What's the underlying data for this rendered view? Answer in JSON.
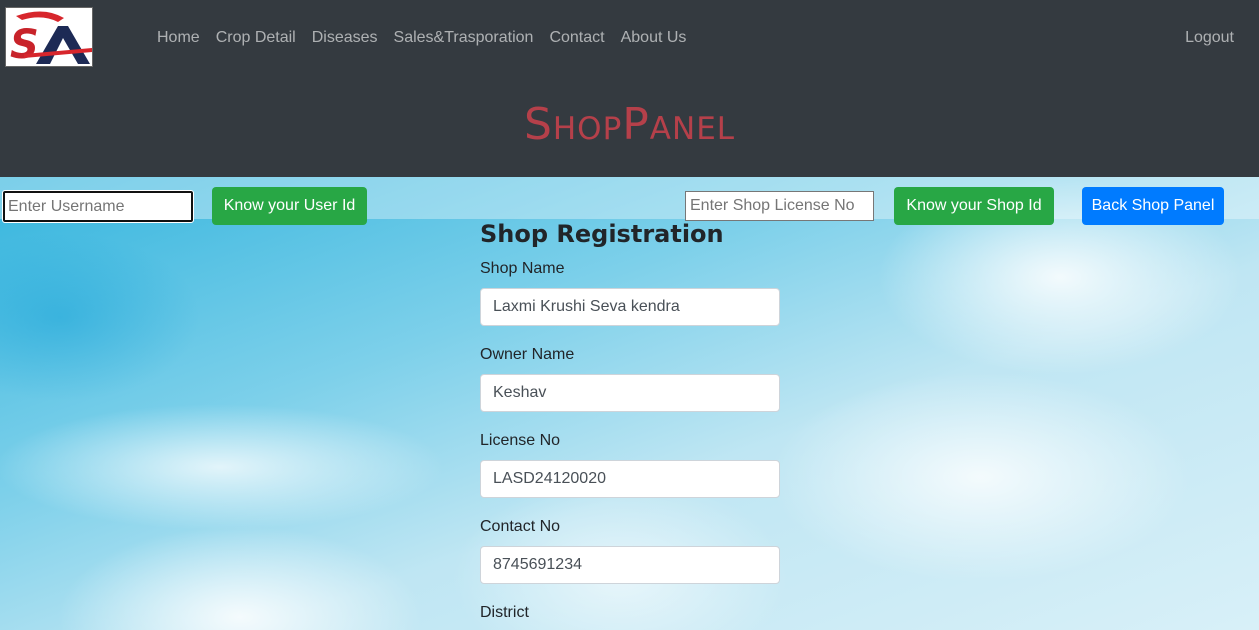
{
  "header": {
    "logo_text": "SA",
    "nav": [
      "Home",
      "Crop Detail",
      "Diseases",
      "Sales&Trasporation",
      "Contact",
      "About Us"
    ],
    "logout": "Logout",
    "title": "ShopPanel"
  },
  "toolbar": {
    "username_placeholder": "Enter Username",
    "know_user_id": "Know your User Id",
    "license_placeholder": "Enter Shop License No",
    "know_shop_id": "Know your Shop Id",
    "back_shop_panel": "Back Shop Panel"
  },
  "form": {
    "title": "Shop Registration",
    "shop_name_label": "Shop Name",
    "shop_name": "Laxmi Krushi Seva kendra",
    "owner_name_label": "Owner Name",
    "owner_name": "Keshav",
    "license_label": "License No",
    "license_no": "LASD24120020",
    "contact_label": "Contact No",
    "contact_no": "8745691234",
    "district_label": "District"
  },
  "colors": {
    "header_bg": "#343a40",
    "title_color": "#b5404a",
    "green_button": "#28a745",
    "blue_button": "#007bff"
  }
}
